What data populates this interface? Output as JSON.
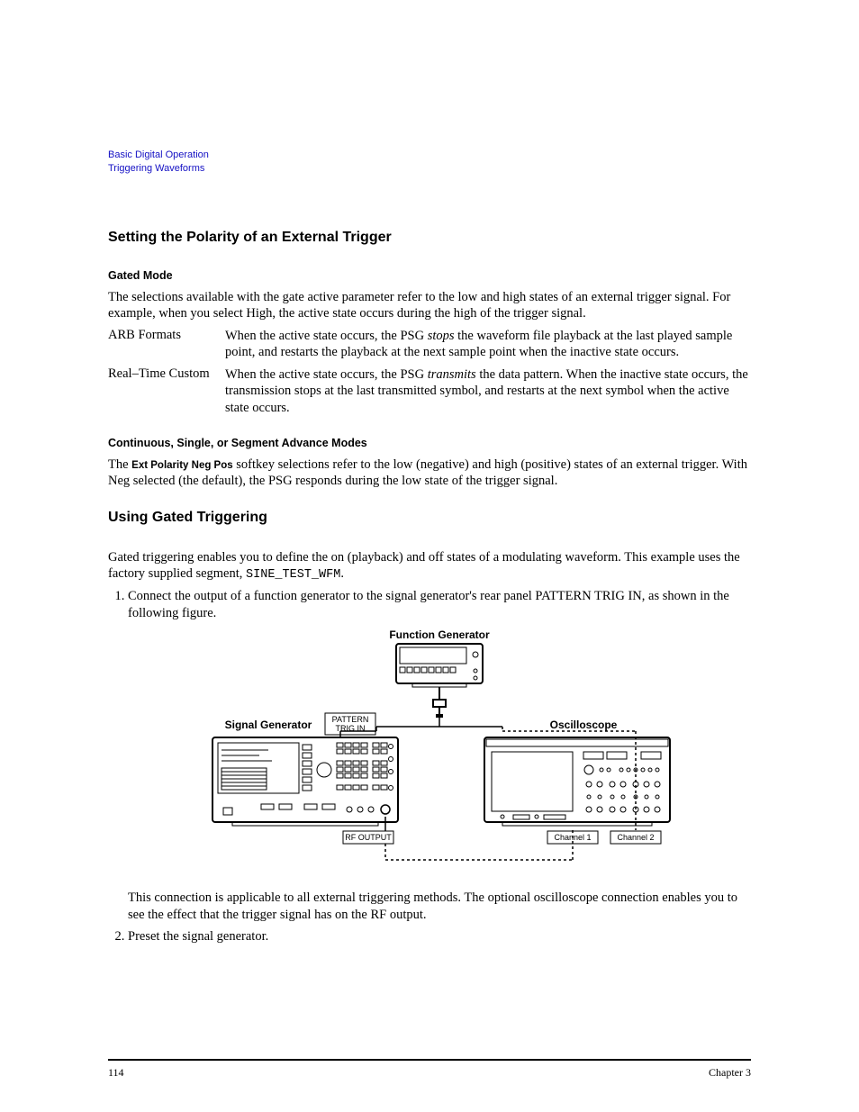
{
  "breadcrumb": {
    "line1": "Basic Digital Operation",
    "line2": "Triggering Waveforms"
  },
  "section1": {
    "title": "Setting the Polarity of an External Trigger",
    "gated": {
      "heading": "Gated Mode",
      "intro": "The selections available with the gate active parameter refer to the low and high states of an external trigger signal. For example, when you select High, the active state occurs during the high of the trigger signal.",
      "arb": {
        "term": "ARB Formats",
        "desc_pre": "When the active state occurs, the PSG ",
        "desc_em": "stops",
        "desc_post": " the waveform file playback at the last played sample point, and restarts the playback at the next sample point when the inactive state occurs."
      },
      "rtc": {
        "term": "Real–Time Custom",
        "desc_pre": "When the active state occurs, the PSG ",
        "desc_em": "transmits",
        "desc_post": " the data pattern. When the inactive state occurs, the transmission stops at the last transmitted symbol, and restarts at the next symbol when the active state occurs."
      }
    },
    "cont": {
      "heading": "Continuous, Single, or Segment Advance Modes",
      "para_pre": "The ",
      "para_key": "Ext Polarity Neg Pos",
      "para_post": " softkey selections refer to the low (negative) and high (positive) states of an external trigger. With Neg selected (the default), the PSG responds during the low state of the trigger signal."
    }
  },
  "section2": {
    "title": "Using Gated Triggering",
    "intro_pre": "Gated triggering enables you to define the on (playback) and off states of a modulating waveform. This example uses the factory supplied segment, ",
    "intro_mono": "SINE_TEST_WFM",
    "intro_post": ".",
    "step1": "Connect the output of a function generator to the signal generator's rear panel PATTERN TRIG IN, as shown in the following figure.",
    "step1_after": "This connection is applicable to all external triggering methods. The optional oscilloscope connection enables you to see the effect that the trigger signal has on the RF output.",
    "step2": "Preset the signal generator."
  },
  "figure": {
    "func_gen": "Function Generator",
    "sig_gen": "Signal Generator",
    "oscope": "Oscilloscope",
    "pattern1": "PATTERN",
    "pattern2": "TRIG IN",
    "rf_output": "RF OUTPUT",
    "ch1": "Channel 1",
    "ch2": "Channel 2"
  },
  "footer": {
    "page": "114",
    "chapter": "Chapter 3"
  }
}
